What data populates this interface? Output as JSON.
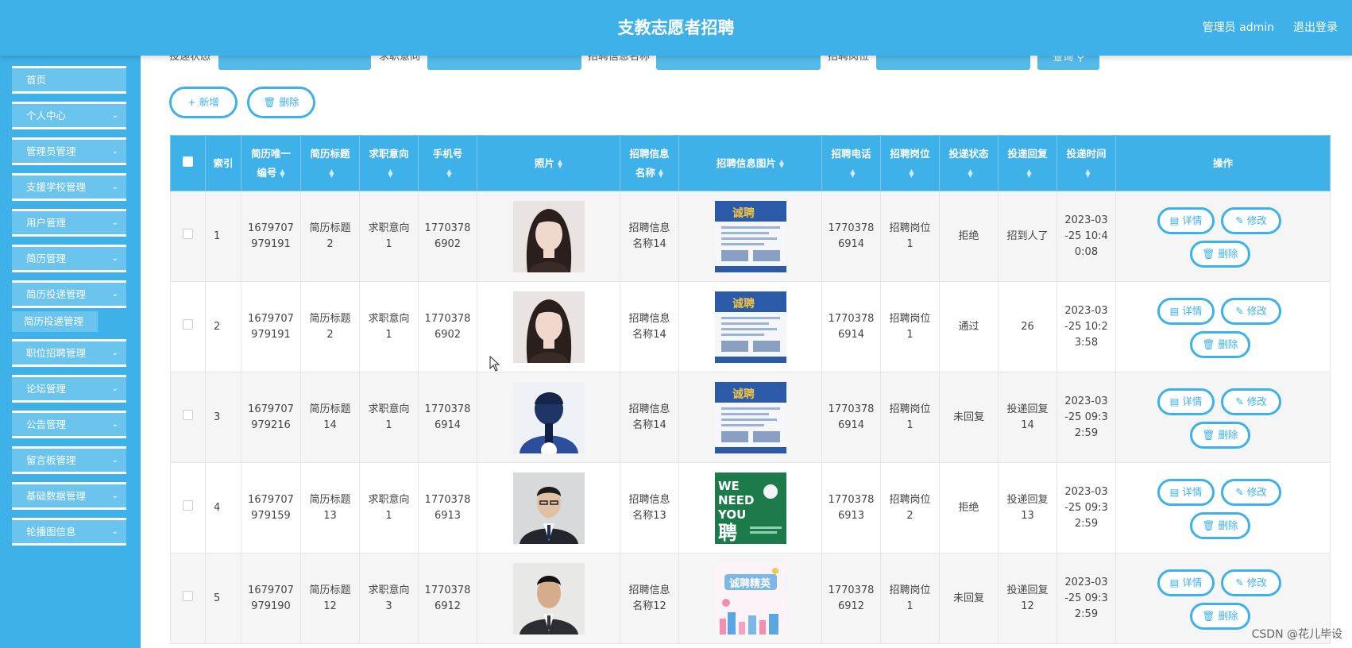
{
  "header": {
    "title": "支教志愿者招聘",
    "admin_label": "管理员 admin",
    "logout_label": "退出登录"
  },
  "sidebar": {
    "items": [
      {
        "label": "首页",
        "has_arrow": false
      },
      {
        "label": "个人中心",
        "has_arrow": true
      },
      {
        "label": "管理员管理",
        "has_arrow": true
      },
      {
        "label": "支援学校管理",
        "has_arrow": true
      },
      {
        "label": "用户管理",
        "has_arrow": true
      },
      {
        "label": "简历管理",
        "has_arrow": true
      },
      {
        "label": "简历投递管理",
        "has_arrow": true
      },
      {
        "label": "职位招聘管理",
        "has_arrow": true
      },
      {
        "label": "论坛管理",
        "has_arrow": true
      },
      {
        "label": "公告管理",
        "has_arrow": true
      },
      {
        "label": "留言板管理",
        "has_arrow": true
      },
      {
        "label": "基础数据管理",
        "has_arrow": true
      },
      {
        "label": "轮播图信息",
        "has_arrow": true
      }
    ],
    "submenu_active": "简历投递管理",
    "chevron_icon": "chevron-down-icon"
  },
  "filters": {
    "status_label": "投递状态",
    "intent_label": "求职意向",
    "info_name_label": "招聘信息名称",
    "position_label": "招聘岗位",
    "query_label": "查询"
  },
  "actions": {
    "add_label": "+ 新增",
    "delete_label": "删除"
  },
  "table": {
    "headers": {
      "index": "索引",
      "resume_id": [
        "简历唯一",
        "编号"
      ],
      "resume_title": "简历标题",
      "intent": "求职意向",
      "phone": "手机号",
      "photo": "照片",
      "info_name": [
        "招聘信息",
        "名称"
      ],
      "info_pic": "招聘信息图片",
      "rec_phone": "招聘电话",
      "position": "招聘岗位",
      "status": "投递状态",
      "reply": "投递回复",
      "time": "投递时间",
      "ops": "操作"
    },
    "rows": [
      {
        "index": "1",
        "resume_id": [
          "1679707",
          "979191"
        ],
        "resume_title": [
          "简历标题",
          "2"
        ],
        "intent": [
          "求职意向",
          "1"
        ],
        "phone": [
          "1770378",
          "6902"
        ],
        "photo": "woman-long-hair",
        "info_name": [
          "招聘信息",
          "名称14"
        ],
        "info_pic": "recruit-poster-blue",
        "rec_phone": [
          "1770378",
          "6914"
        ],
        "position": [
          "招聘岗位",
          "1"
        ],
        "status": "拒绝",
        "reply": [
          "招到人了"
        ],
        "time": [
          "2023-03",
          "-25 10:4",
          "0:08"
        ]
      },
      {
        "index": "2",
        "resume_id": [
          "1679707",
          "979191"
        ],
        "resume_title": [
          "简历标题",
          "2"
        ],
        "intent": [
          "求职意向",
          "1"
        ],
        "phone": [
          "1770378",
          "6902"
        ],
        "photo": "woman-long-hair",
        "info_name": [
          "招聘信息",
          "名称14"
        ],
        "info_pic": "recruit-poster-blue",
        "rec_phone": [
          "1770378",
          "6914"
        ],
        "position": [
          "招聘岗位",
          "1"
        ],
        "status": "通过",
        "reply": [
          "26"
        ],
        "time": [
          "2023-03",
          "-25 10:2",
          "3:58"
        ]
      },
      {
        "index": "3",
        "resume_id": [
          "1679707",
          "979216"
        ],
        "resume_title": [
          "简历标题",
          "14"
        ],
        "intent": [
          "求职意向",
          "1"
        ],
        "phone": [
          "1770378",
          "6914"
        ],
        "photo": "anime-boy-blue",
        "info_name": [
          "招聘信息",
          "名称14"
        ],
        "info_pic": "recruit-poster-blue",
        "rec_phone": [
          "1770378",
          "6914"
        ],
        "position": [
          "招聘岗位",
          "1"
        ],
        "status": "未回复",
        "reply": [
          "投递回复",
          "14"
        ],
        "time": [
          "2023-03",
          "-25 09:3",
          "2:59"
        ]
      },
      {
        "index": "4",
        "resume_id": [
          "1679707",
          "979159"
        ],
        "resume_title": [
          "简历标题",
          "13"
        ],
        "intent": [
          "求职意向",
          "1"
        ],
        "phone": [
          "1770378",
          "6913"
        ],
        "photo": "man-suit",
        "info_name": [
          "招聘信息",
          "名称13"
        ],
        "info_pic": "we-need-you-green",
        "rec_phone": [
          "1770378",
          "6913"
        ],
        "position": [
          "招聘岗位",
          "2"
        ],
        "status": "拒绝",
        "reply": [
          "投递回复",
          "13"
        ],
        "time": [
          "2023-03",
          "-25 09:3",
          "2:59"
        ]
      },
      {
        "index": "5",
        "resume_id": [
          "1679707",
          "979190"
        ],
        "resume_title": [
          "简历标题",
          "12"
        ],
        "intent": [
          "求职意向",
          "3"
        ],
        "phone": [
          "1770378",
          "6912"
        ],
        "photo": "man-suit-2",
        "info_name": [
          "招聘信息",
          "名称12"
        ],
        "info_pic": "city-recruit-pink",
        "rec_phone": [
          "1770378",
          "6912"
        ],
        "position": [
          "招聘岗位",
          "1"
        ],
        "status": "未回复",
        "reply": [
          "投递回复",
          "12"
        ],
        "time": [
          "2023-03",
          "-25 09:3",
          "2:59"
        ]
      }
    ],
    "op_labels": {
      "detail": "详情",
      "edit": "修改",
      "delete": "删除"
    }
  },
  "watermark": "CSDN @花儿毕设",
  "colors": {
    "primary": "#3db1e8",
    "menu_item": "#6ac4ee"
  }
}
